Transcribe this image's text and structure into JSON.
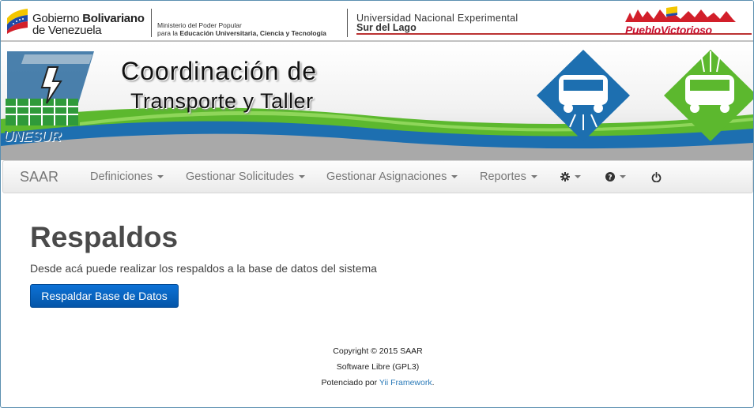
{
  "gov": {
    "name_prefix": "Gobierno ",
    "name_bold": "Bolivariano",
    "name_line2": "de Venezuela",
    "ministry_line1": "Ministerio del Poder Popular",
    "ministry_prefix": "para la ",
    "ministry_bold": "Educación Universitaria, Ciencia y Tecnología",
    "university_line1": "Universidad Nacional Experimental",
    "university_line2": "Sur del Lago",
    "campaign_logo": "PuebloVictorioso"
  },
  "banner": {
    "title_line1": "Coordinación de",
    "title_line2": "Transporte y Taller",
    "logo_text": "UNESUR"
  },
  "navbar": {
    "brand": "SAAR",
    "items": [
      {
        "label": "Definiciones"
      },
      {
        "label": "Gestionar Solicitudes"
      },
      {
        "label": "Gestionar Asignaciones"
      },
      {
        "label": "Reportes"
      }
    ],
    "icons": [
      "gear-icon",
      "help-icon",
      "power-icon"
    ]
  },
  "main": {
    "title": "Respaldos",
    "description": "Desde acá puede realizar los respaldos a la base de datos del sistema",
    "backup_button": "Respaldar Base de Datos"
  },
  "footer": {
    "copyright": "Copyright © 2015 SAAR",
    "license": "Software Libre (GPL3)",
    "powered_prefix": "Potenciado por ",
    "powered_link": "Yii Framework",
    "powered_suffix": "."
  },
  "colors": {
    "primary_button": "#0b63c4",
    "link": "#2a7ab8",
    "banner_green": "#5cb82e",
    "banner_blue": "#1d6fb0"
  }
}
